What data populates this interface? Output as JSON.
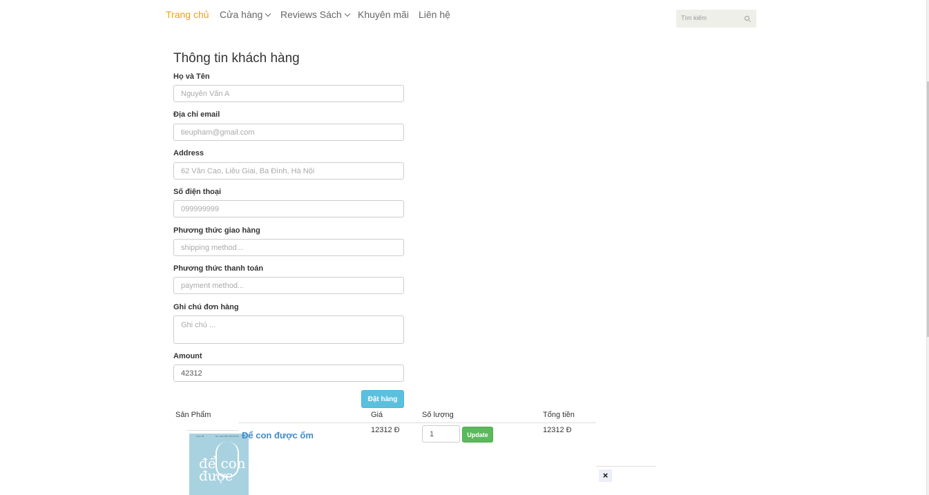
{
  "nav": {
    "items": [
      {
        "label": "Trang chủ"
      },
      {
        "label": "Cửa hàng"
      },
      {
        "label": "Reviews Sách"
      },
      {
        "label": "Khuyên mãi"
      },
      {
        "label": "Liên hệ"
      }
    ],
    "search_placeholder": "Tìm kiếm",
    "active_color": "#f0a30a"
  },
  "form": {
    "title": "Thông tin khách hàng",
    "name": {
      "label": "Họ và Tên",
      "placeholder": "Nguyễn Văn A"
    },
    "email": {
      "label": "Địa chỉ email",
      "placeholder": "tieupham@gmail.com"
    },
    "address": {
      "label": "Address",
      "placeholder": "62 Văn Cao, Liễu Giai, Ba Đình, Hà Nội"
    },
    "phone": {
      "label": "Số điện thoại",
      "placeholder": "099999999"
    },
    "shipping": {
      "label": "Phương thức giao hàng",
      "placeholder": "shipping method..."
    },
    "payment": {
      "label": "Phương thức thanh toán",
      "placeholder": "payment method..."
    },
    "note": {
      "label": "Ghi chú đơn hàng",
      "placeholder": "Ghi chú ..."
    },
    "amount": {
      "label": "Amount",
      "value": "42312"
    },
    "submit_label": "Đặt hàng"
  },
  "cart": {
    "headers": {
      "product": "Sản Phẩm",
      "price": "Giá",
      "quantity": "Số lượng",
      "total": "Tổng tiền"
    },
    "items": [
      {
        "name": "Để con được ốm",
        "price": "12312 Đ",
        "quantity": "1",
        "total": "12312 Đ",
        "update_label": "Update",
        "remove_icon": "×",
        "cover": {
          "title": "để con được",
          "author": "DS. NGUYỄN TRÍ ĐOÀN",
          "tag": "UNG TẾ"
        }
      }
    ]
  }
}
